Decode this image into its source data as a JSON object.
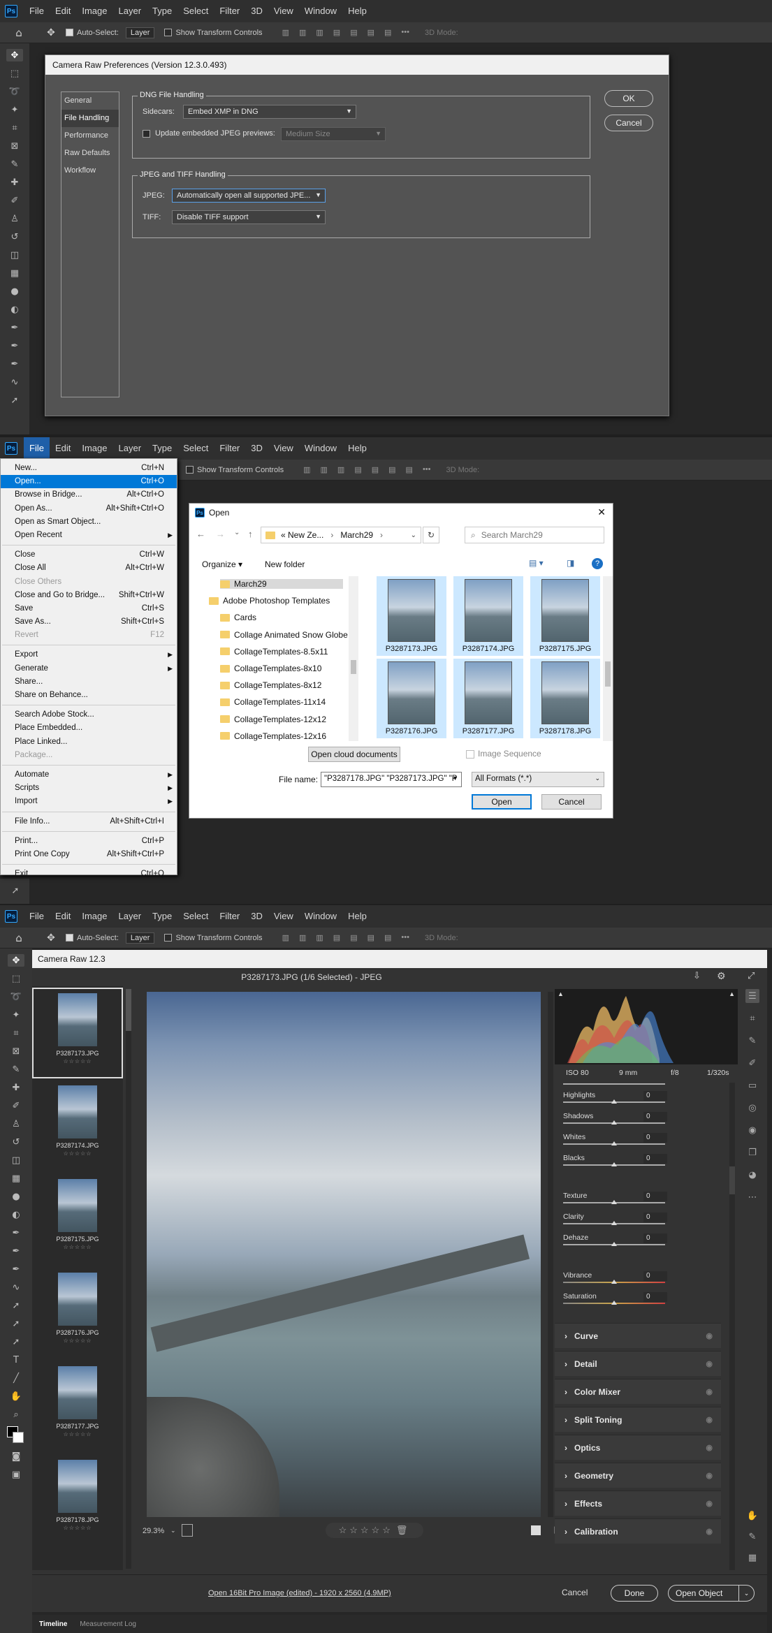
{
  "menubar": {
    "items": [
      "File",
      "Edit",
      "Image",
      "Layer",
      "Type",
      "Select",
      "Filter",
      "3D",
      "View",
      "Window",
      "Help"
    ]
  },
  "optbar": {
    "auto_select": "Auto-Select:",
    "layer": "Layer",
    "show_transform": "Show Transform Controls",
    "mode3d": "3D Mode:"
  },
  "prefs": {
    "title": "Camera Raw Preferences  (Version 12.3.0.493)",
    "nav": [
      "General",
      "File Handling",
      "Performance",
      "Raw Defaults",
      "Workflow"
    ],
    "dng_legend": "DNG File Handling",
    "sidecars_label": "Sidecars:",
    "sidecars_value": "Embed XMP in DNG",
    "update_previews_label": "Update embedded JPEG previews:",
    "update_previews_value": "Medium Size",
    "jpeg_tiff_legend": "JPEG and TIFF Handling",
    "jpeg_label": "JPEG:",
    "jpeg_value": "Automatically open all supported JPE...",
    "tiff_label": "TIFF:",
    "tiff_value": "Disable TIFF support",
    "ok": "OK",
    "cancel": "Cancel"
  },
  "file_menu": {
    "items": [
      {
        "label": "New...",
        "shortcut": "Ctrl+N"
      },
      {
        "label": "Open...",
        "shortcut": "Ctrl+O",
        "highlight": true
      },
      {
        "label": "Browse in Bridge...",
        "shortcut": "Alt+Ctrl+O"
      },
      {
        "label": "Open As...",
        "shortcut": "Alt+Shift+Ctrl+O"
      },
      {
        "label": "Open as Smart Object..."
      },
      {
        "label": "Open Recent",
        "submenu": true
      },
      {
        "sep": true
      },
      {
        "label": "Close",
        "shortcut": "Ctrl+W"
      },
      {
        "label": "Close All",
        "shortcut": "Alt+Ctrl+W"
      },
      {
        "label": "Close Others",
        "disabled": true
      },
      {
        "label": "Close and Go to Bridge...",
        "shortcut": "Shift+Ctrl+W"
      },
      {
        "label": "Save",
        "shortcut": "Ctrl+S"
      },
      {
        "label": "Save As...",
        "shortcut": "Shift+Ctrl+S"
      },
      {
        "label": "Revert",
        "shortcut": "F12",
        "disabled": true
      },
      {
        "sep": true
      },
      {
        "label": "Export",
        "submenu": true
      },
      {
        "label": "Generate",
        "submenu": true
      },
      {
        "label": "Share..."
      },
      {
        "label": "Share on Behance..."
      },
      {
        "sep": true
      },
      {
        "label": "Search Adobe Stock..."
      },
      {
        "label": "Place Embedded..."
      },
      {
        "label": "Place Linked..."
      },
      {
        "label": "Package...",
        "disabled": true
      },
      {
        "sep": true
      },
      {
        "label": "Automate",
        "submenu": true
      },
      {
        "label": "Scripts",
        "submenu": true
      },
      {
        "label": "Import",
        "submenu": true
      },
      {
        "sep": true
      },
      {
        "label": "File Info...",
        "shortcut": "Alt+Shift+Ctrl+I"
      },
      {
        "sep": true
      },
      {
        "label": "Print...",
        "shortcut": "Ctrl+P"
      },
      {
        "label": "Print One Copy",
        "shortcut": "Alt+Shift+Ctrl+P"
      },
      {
        "sep": true
      },
      {
        "label": "Exit",
        "shortcut": "Ctrl+Q"
      }
    ]
  },
  "open_dialog": {
    "title": "Open",
    "breadcrumb": [
      "« New Ze...",
      "March29"
    ],
    "search_placeholder": "Search March29",
    "organize": "Organize ▾",
    "new_folder": "New folder",
    "tree": [
      "March29",
      "Adobe Photoshop Templates",
      "Cards",
      "Collage Animated Snow Globe",
      "CollageTemplates-8.5x11",
      "CollageTemplates-8x10",
      "CollageTemplates-8x12",
      "CollageTemplates-11x14",
      "CollageTemplates-12x12",
      "CollageTemplates-12x16"
    ],
    "files": [
      "P3287173.JPG",
      "P3287174.JPG",
      "P3287175.JPG",
      "P3287176.JPG",
      "P3287177.JPG",
      "P3287178.JPG"
    ],
    "open_cloud": "Open cloud documents",
    "image_sequence": "Image Sequence",
    "filename_label": "File name:",
    "filename_value": "\"P3287178.JPG\" \"P3287173.JPG\" \"P",
    "filetype": "All Formats (*.*)",
    "open": "Open",
    "cancel": "Cancel"
  },
  "camera_raw": {
    "title": "Camera Raw 12.3",
    "header": "P3287173.JPG (1/6 Selected)  -  JPEG",
    "filmstrip": [
      "P3287173.JPG",
      "P3287174.JPG",
      "P3287175.JPG",
      "P3287176.JPG",
      "P3287177.JPG",
      "P3287178.JPG"
    ],
    "stars": "☆☆☆☆☆",
    "exif": {
      "iso": "ISO 80",
      "focal": "9 mm",
      "aperture": "f/8",
      "shutter": "1/320s"
    },
    "sliders": [
      {
        "name": "Highlights",
        "value": "0"
      },
      {
        "name": "Shadows",
        "value": "0"
      },
      {
        "name": "Whites",
        "value": "0"
      },
      {
        "name": "Blacks",
        "value": "0"
      },
      {
        "name": "Texture",
        "value": "0"
      },
      {
        "name": "Clarity",
        "value": "0"
      },
      {
        "name": "Dehaze",
        "value": "0"
      },
      {
        "name": "Vibrance",
        "value": "0"
      },
      {
        "name": "Saturation",
        "value": "0"
      }
    ],
    "sections": [
      "Curve",
      "Detail",
      "Color Mixer",
      "Split Toning",
      "Optics",
      "Geometry",
      "Effects",
      "Calibration"
    ],
    "zoom": "29.3%",
    "workflow_link": "Open 16Bit Pro Image (edited) - 1920 x 2560 (4.9MP)",
    "cancel": "Cancel",
    "done": "Done",
    "open_object": "Open Object"
  },
  "bottom_tabs": [
    "Timeline",
    "Measurement Log"
  ]
}
